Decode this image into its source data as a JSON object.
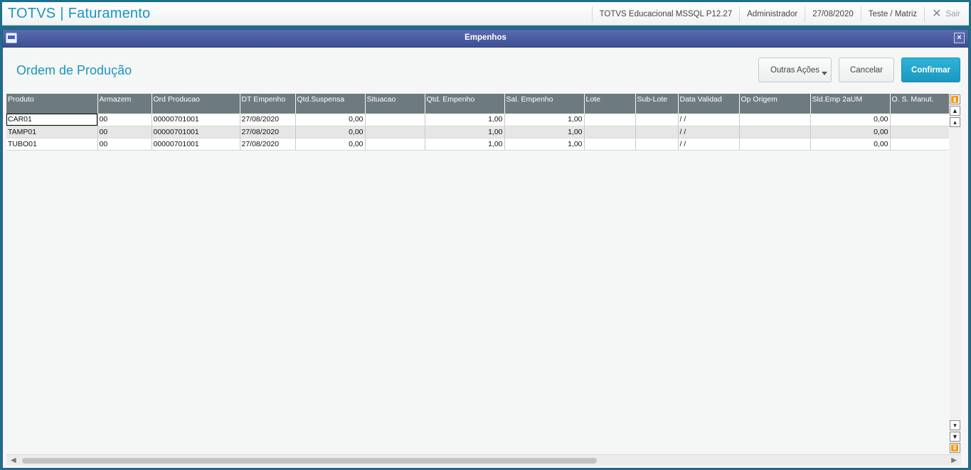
{
  "app": {
    "title_brand": "TOTVS",
    "title_separator": "|",
    "title_module": "Faturamento",
    "environment": "TOTVS Educacional MSSQL P12.27",
    "user": "Administrador",
    "date": "27/08/2020",
    "company": "Teste / Matriz",
    "logout_label": "Sair"
  },
  "dialog": {
    "title": "Empenhos",
    "close_glyph": "×"
  },
  "page": {
    "title": "Ordem de Produção"
  },
  "buttons": {
    "other_actions": "Outras Ações",
    "cancel": "Cancelar",
    "confirm": "Confirmar"
  },
  "grid": {
    "columns": [
      "Produto",
      "Armazem",
      "Ord Producao",
      "DT Empenho",
      "Qtd.Suspensa",
      "Situacao",
      "Qtd. Empenho",
      "Sal. Empenho",
      "Lote",
      "Sub-Lote",
      "Data Validad",
      "Op Origem",
      "Sld.Emp 2aUM",
      "O. S. Manut."
    ],
    "rows": [
      [
        "CAR01",
        "00",
        "00000701001",
        "27/08/2020",
        "0,00",
        "",
        "1,00",
        "1,00",
        "",
        "",
        " /  /",
        "",
        "0,00",
        ""
      ],
      [
        "TAMP01",
        "00",
        "00000701001",
        "27/08/2020",
        "0,00",
        "",
        "1,00",
        "1,00",
        "",
        "",
        " /  /",
        "",
        "0,00",
        ""
      ],
      [
        "TUBO01",
        "00",
        "00000701001",
        "27/08/2020",
        "0,00",
        "",
        "1,00",
        "1,00",
        "",
        "",
        " /  /",
        "",
        "0,00",
        ""
      ]
    ]
  },
  "colors": {
    "brand": "#1a96bd",
    "header_bg": "#6d7b80",
    "titlebar": "#3e4f93",
    "confirm": "#1b98bf"
  }
}
